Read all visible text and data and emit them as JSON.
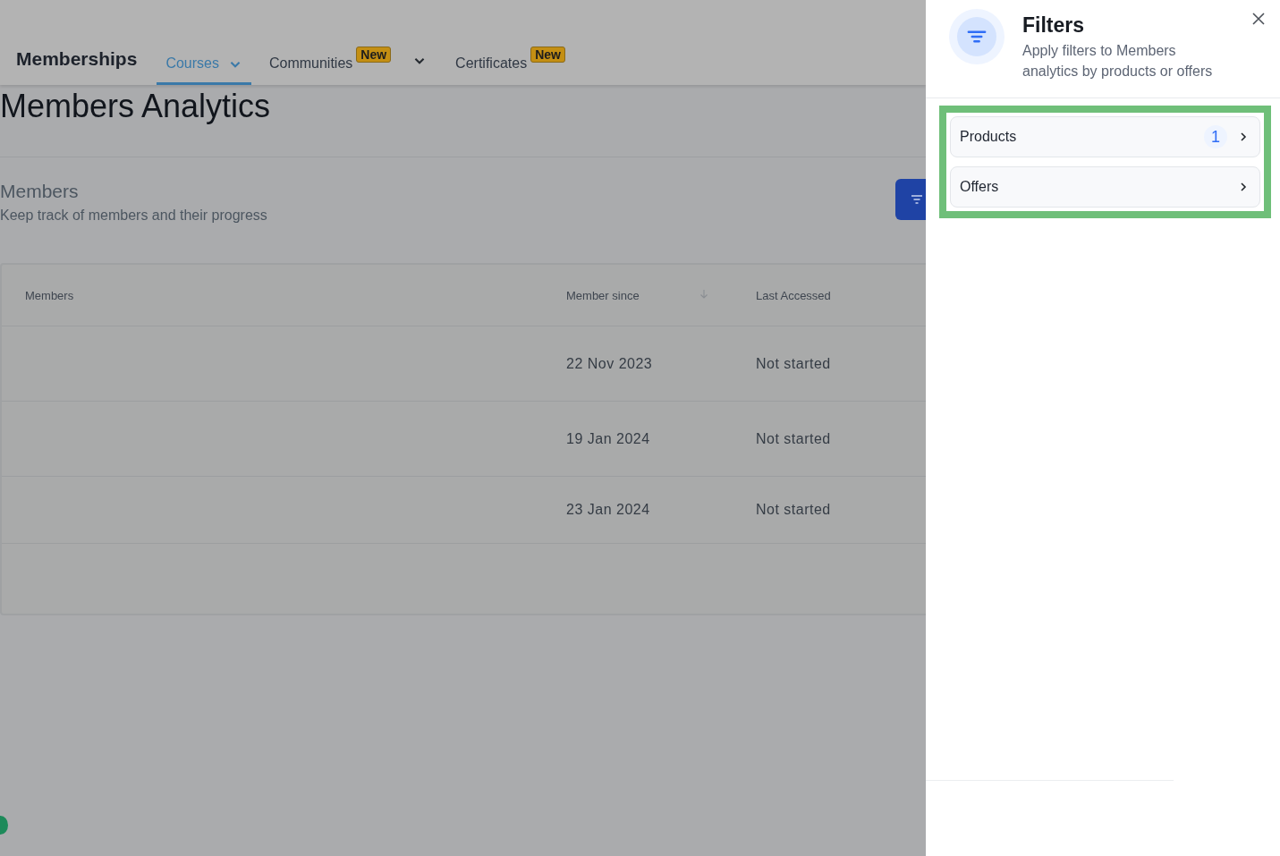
{
  "nav": {
    "title": "Memberships",
    "tabs": [
      {
        "label": "Courses",
        "selected": true,
        "caret": true
      },
      {
        "label": "Communities",
        "selected": false,
        "caret": true,
        "badge": "New"
      },
      {
        "label": "Certificates",
        "selected": false,
        "caret": false,
        "badge": "New"
      }
    ]
  },
  "page": {
    "title": "Members Analytics",
    "section_title": "Members",
    "section_subtitle": "Keep track of members and their progress"
  },
  "table": {
    "columns": [
      "Members",
      "Member since",
      "Last Accessed"
    ],
    "rows": [
      {
        "member_since": "22 Nov 2023",
        "last_accessed": "Not started"
      },
      {
        "member_since": "19 Jan 2024",
        "last_accessed": "Not started"
      },
      {
        "member_since": "23 Jan 2024",
        "last_accessed": "Not started"
      }
    ]
  },
  "filters_panel": {
    "title": "Filters",
    "subtitle": "Apply filters to Members analytics by products or offers",
    "items": [
      {
        "label": "Products",
        "count": "1"
      },
      {
        "label": "Offers"
      }
    ]
  }
}
